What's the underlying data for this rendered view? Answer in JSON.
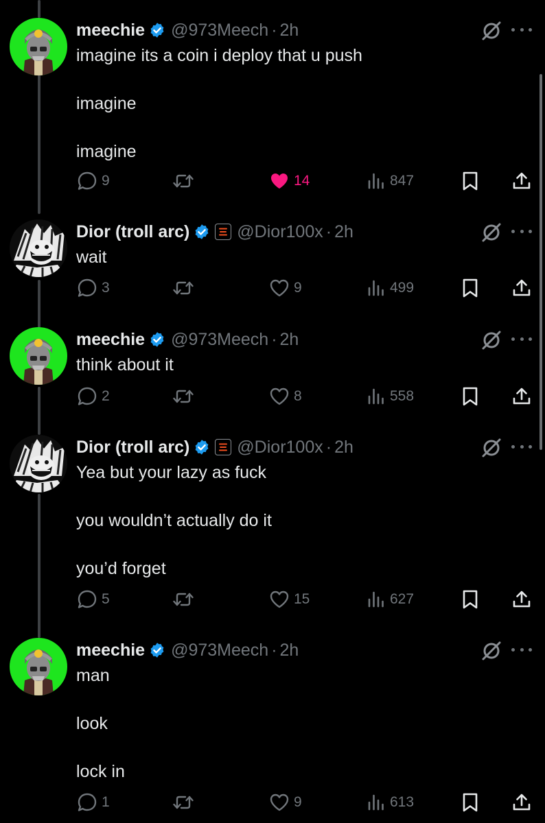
{
  "colors": {
    "background": "#000000",
    "text_primary": "#e7e9ea",
    "text_secondary": "#71767b",
    "verified_blue": "#1d9bf0",
    "like_pink": "#f91880",
    "avatar_green": "#1ee51e",
    "affiliate_badge": "#f24e1e"
  },
  "icons": {
    "reply": "speech-bubble",
    "repost": "two-arrows-loop",
    "like": "heart",
    "views": "bar-chart",
    "bookmark": "bookmark",
    "share": "upload-arrow",
    "grok": "slashed-circle",
    "more": "three-dots"
  },
  "tweets": [
    {
      "name": "meechie",
      "handle": "@973Meech",
      "separator": "·",
      "time": "2h",
      "lines": [
        "imagine its a coin i deploy that u push",
        "imagine",
        "imagine"
      ],
      "replies": "9",
      "reposts": "",
      "likes": "14",
      "liked": true,
      "views": "847"
    },
    {
      "name": "Dior (troll arc)",
      "handle": "@Dior100x",
      "separator": "·",
      "time": "2h",
      "lines": [
        "wait"
      ],
      "replies": "3",
      "reposts": "",
      "likes": "9",
      "liked": false,
      "views": "499"
    },
    {
      "name": "meechie",
      "handle": "@973Meech",
      "separator": "·",
      "time": "2h",
      "lines": [
        "think about it"
      ],
      "replies": "2",
      "reposts": "",
      "likes": "8",
      "liked": false,
      "views": "558"
    },
    {
      "name": "Dior (troll arc)",
      "handle": "@Dior100x",
      "separator": "·",
      "time": "2h",
      "lines": [
        "Yea but your lazy as fuck",
        "you wouldn’t actually do it",
        "you’d forget"
      ],
      "replies": "5",
      "reposts": "",
      "likes": "15",
      "liked": false,
      "views": "627"
    },
    {
      "name": "meechie",
      "handle": "@973Meech",
      "separator": "·",
      "time": "2h",
      "lines": [
        "man",
        "look",
        "lock in"
      ],
      "replies": "1",
      "reposts": "",
      "likes": "9",
      "liked": false,
      "views": "613"
    }
  ]
}
